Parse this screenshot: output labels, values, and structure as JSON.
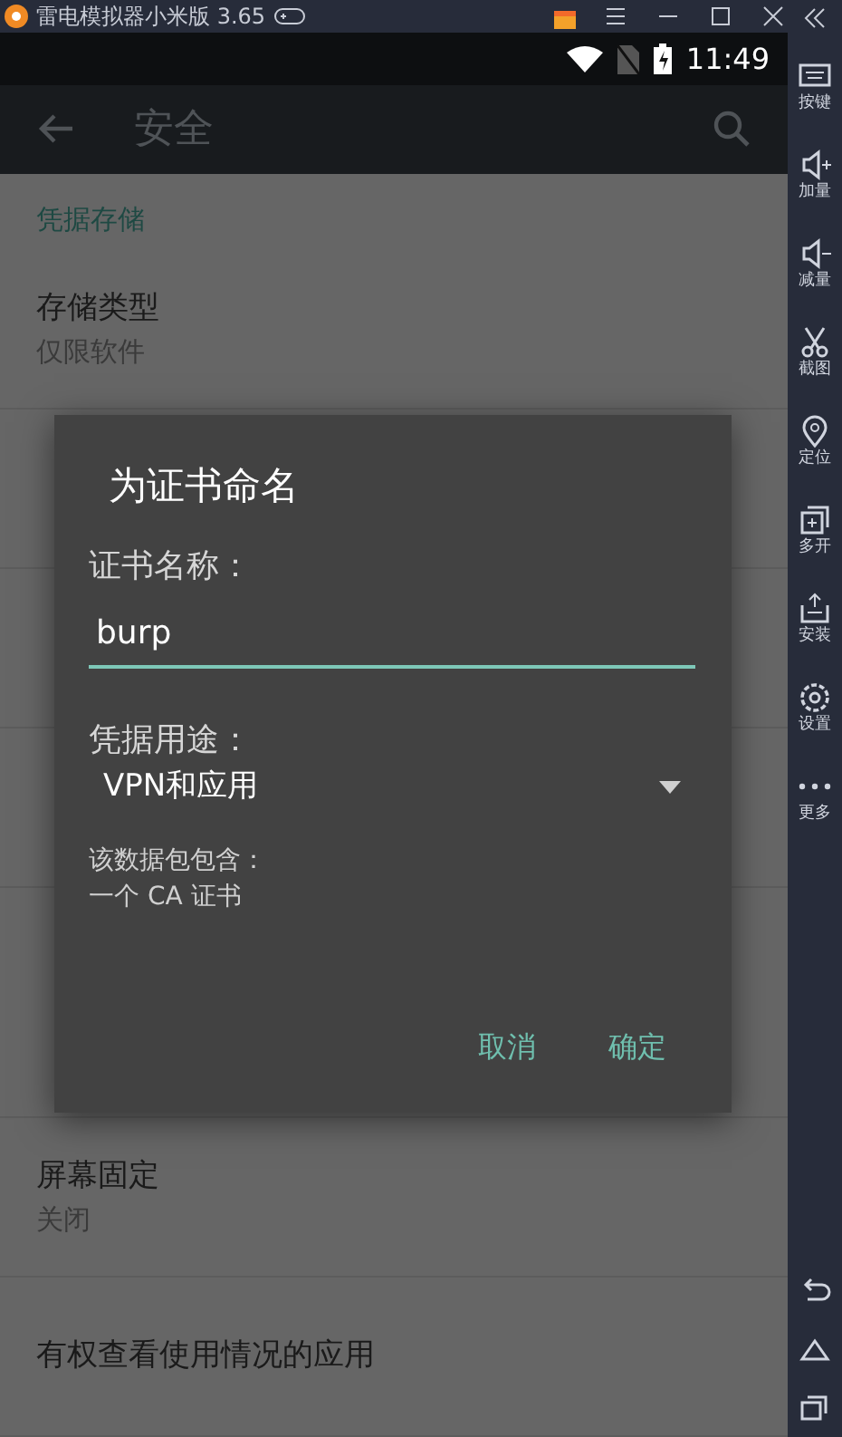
{
  "emulator_title_bar": {
    "title": "雷电模拟器小米版 3.65"
  },
  "status_bar": {
    "time": "11:49"
  },
  "app_bar": {
    "title": "安全"
  },
  "settings": [
    {
      "kind": "header",
      "title": "凭据存储"
    },
    {
      "kind": "item",
      "title": "存储类型",
      "summary": "仅限软件",
      "disabled": false
    },
    {
      "kind": "covered_item"
    },
    {
      "kind": "covered_item"
    },
    {
      "kind": "covered_item"
    },
    {
      "kind": "covered_header"
    },
    {
      "kind": "covered_item"
    },
    {
      "kind": "item",
      "title": "屏幕固定",
      "summary": "关闭",
      "disabled": false
    },
    {
      "kind": "item",
      "title": "有权查看使用情况的应用",
      "disabled": false
    }
  ],
  "dialog": {
    "title": "为证书命名",
    "name_label": "证书名称：",
    "name_value": "burp",
    "usage_label": "凭据用途：",
    "usage_value": "VPN和应用",
    "info": [
      "该数据包包含：",
      "一个 CA 证书"
    ],
    "buttons": [
      "取消",
      "确定"
    ]
  },
  "side_toolbar": [
    {
      "kind": "keyboard",
      "label": "按键"
    },
    {
      "kind": "volup",
      "label": "加量"
    },
    {
      "kind": "voldown",
      "label": "减量"
    },
    {
      "kind": "scissors",
      "label": "截图"
    },
    {
      "kind": "pin",
      "label": "定位"
    },
    {
      "kind": "multi",
      "label": "多开"
    },
    {
      "kind": "apk",
      "label": "安装"
    },
    {
      "kind": "gear",
      "label": "设置"
    },
    {
      "kind": "dots",
      "label": "更多"
    }
  ]
}
